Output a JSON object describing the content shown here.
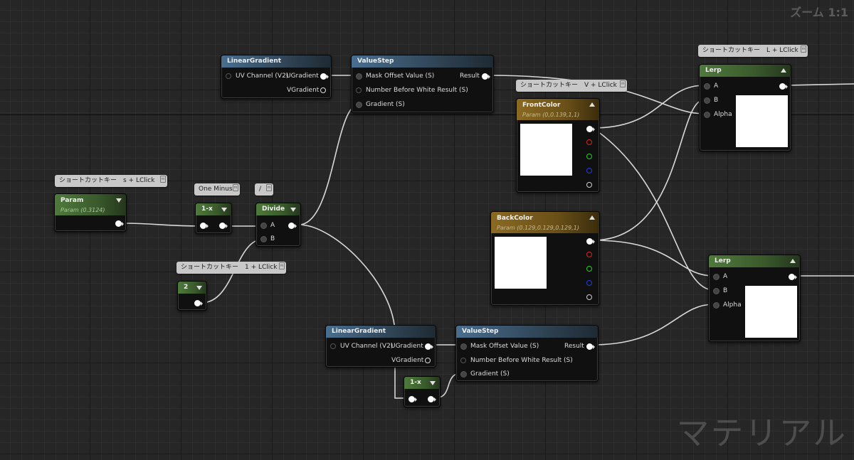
{
  "zoom_label": "ズーム 1:1",
  "watermark": "マテリアル",
  "comments": {
    "param": "ショートカットキー　s + LClick",
    "one_minus": "One Minus",
    "divide": "/",
    "const2": "ショートカットキー　1 + LClick",
    "frontcolor": "ショートカットキー　V + LClick",
    "lerp": "ショートカットキー　L + LClick"
  },
  "nodes": {
    "param": {
      "title": "Param",
      "subtitle": "Param (0.3124)"
    },
    "one_minus_top": {
      "title": "1-x"
    },
    "divide": {
      "title": "Divide",
      "a": "A",
      "b": "B"
    },
    "const2": {
      "title": "2"
    },
    "linear_gradient_top": {
      "title": "LinearGradient",
      "uv": "UV Channel (V2)",
      "ugrad": "UGradient",
      "vgrad": "VGradient"
    },
    "valuestep_top": {
      "title": "ValueStep",
      "mask": "Mask Offset Value (S)",
      "result": "Result",
      "nbw": "Number Before White Result (S)",
      "gradient": "Gradient (S)"
    },
    "frontcolor": {
      "title": "FrontColor",
      "subtitle": "Param (0,0.139,1,1)"
    },
    "backcolor": {
      "title": "BackColor",
      "subtitle": "Param (0.129,0.129,0.129,1)"
    },
    "lerp_top": {
      "title": "Lerp",
      "a": "A",
      "b": "B",
      "alpha": "Alpha"
    },
    "lerp_bottom": {
      "title": "Lerp",
      "a": "A",
      "b": "B",
      "alpha": "Alpha"
    },
    "linear_gradient_bottom": {
      "title": "LinearGradient",
      "uv": "UV Channel (V2)",
      "ugrad": "UGradient",
      "vgrad": "VGradient"
    },
    "valuestep_bottom": {
      "title": "ValueStep",
      "mask": "Mask Offset Value (S)",
      "result": "Result",
      "nbw": "Number Before White Result (S)",
      "gradient": "Gradient (S)"
    },
    "one_minus_bottom": {
      "title": "1-x"
    }
  }
}
